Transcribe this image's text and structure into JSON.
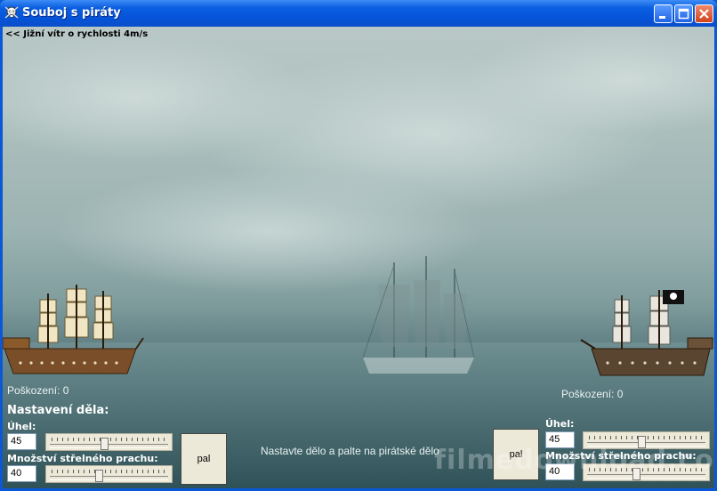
{
  "window": {
    "title": "Souboj s piráty"
  },
  "wind": {
    "text": "<< Jižní vítr o rychlosti 4m/s"
  },
  "player": {
    "damage": "Poškození: 0",
    "setup_title": "Nastavení děla:",
    "angle_label": "Úhel:",
    "angle_value": "45",
    "angle_slider_value": 45,
    "powder_label": "Množství střelného prachu:",
    "powder_value": "40",
    "powder_slider_value": 40,
    "fire_label": "pal"
  },
  "pirate": {
    "damage": "Poškození: 0",
    "angle_label": "Úhel:",
    "angle_value": "45",
    "angle_slider_value": 45,
    "powder_label": "Množství střelného prachu:",
    "powder_value": "40",
    "powder_slider_value": 40,
    "fire_label": "pal"
  },
  "status": {
    "message": "Nastavte dělo a palte na pirátské dělo"
  },
  "watermark": {
    "text": "filmedownload.com"
  },
  "colors": {
    "titlebar": "#0553d8",
    "sky": "#a9bdbb",
    "sea": "#3c5f66",
    "ship_hull": "#7a4e28"
  }
}
